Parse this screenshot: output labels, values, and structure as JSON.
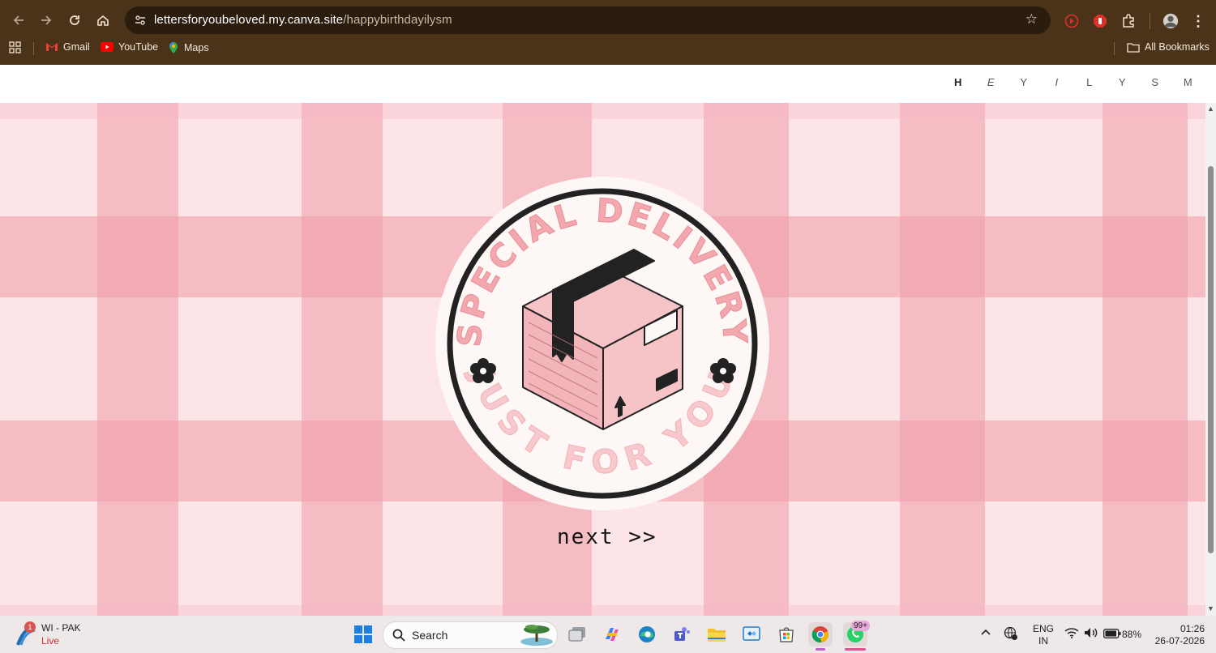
{
  "browser": {
    "url_host": "lettersforyoubeloved.my.canva.site",
    "url_path": "/happybirthdayilysm",
    "bookmarks": [
      {
        "label": "Gmail",
        "icon": "gmail-icon"
      },
      {
        "label": "YouTube",
        "icon": "youtube-icon"
      },
      {
        "label": "Maps",
        "icon": "maps-icon"
      }
    ],
    "all_bookmarks": "All Bookmarks",
    "colors": {
      "frame": "#4a3319",
      "omnibox": "#2b1d0e"
    }
  },
  "site_nav": {
    "letters": [
      "H",
      "E",
      "Y",
      "I",
      "L",
      "Y",
      "S",
      "M"
    ],
    "active": "H"
  },
  "hero": {
    "badge_top_text": "SPECIAL DELIVERY",
    "badge_bottom_text": "JUST FOR YOU",
    "next_label": "next >>",
    "colors": {
      "pink": "#f3b3b7",
      "dark_pink": "#e98e98",
      "ink": "#222222",
      "box": "#f6c3c6"
    }
  },
  "taskbar": {
    "weather_badge": "1",
    "weather_title": "WI - PAK",
    "weather_sub": "Live",
    "search_placeholder": "Search",
    "whatsapp_badge": "99+",
    "lang_top": "ENG",
    "lang_bottom": "IN",
    "battery": "88%",
    "time": "01:26",
    "date": "26-07-2026"
  }
}
